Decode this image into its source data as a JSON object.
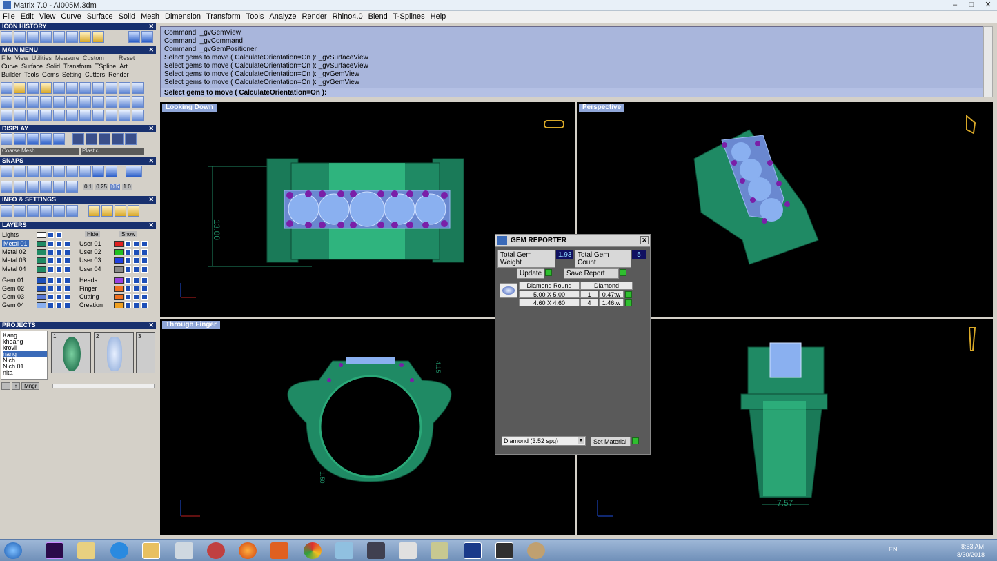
{
  "window": {
    "title": "Matrix 7.0 - AI005M.3dm",
    "controls": [
      "–",
      "□",
      "✕"
    ]
  },
  "menu": [
    "File",
    "Edit",
    "View",
    "Curve",
    "Surface",
    "Solid",
    "Mesh",
    "Dimension",
    "Transform",
    "Tools",
    "Analyze",
    "Render",
    "Rhino4.0",
    "Blend",
    "T-Splines",
    "Help"
  ],
  "left": {
    "icon_history": "ICON HISTORY",
    "main_menu": "MAIN MENU",
    "main_menu_row1": [
      "File",
      "View",
      "Utilities",
      "Measure",
      "Custom"
    ],
    "reset": "Reset",
    "main_menu_row2": [
      "Curve",
      "Surface",
      "Solid",
      "Transform",
      "TSpline",
      "Art"
    ],
    "main_menu_row3": [
      "Builder",
      "Tools",
      "Gems",
      "Setting",
      "Cutters",
      "Render"
    ],
    "display": "DISPLAY",
    "display_mesh": "Coarse Mesh",
    "display_material": "Plastic",
    "snaps": "SNAPS",
    "snap_values": [
      "0.1",
      "0.25",
      "0.5",
      "1.0"
    ],
    "info_settings": "INFO & SETTINGS",
    "layers": "LAYERS",
    "lights": "Lights",
    "hide": "Hide",
    "show": "Show",
    "layers_left": [
      "Metal 01",
      "Metal 02",
      "Metal 03",
      "Metal 04",
      "Gem 01",
      "Gem 02",
      "Gem 03",
      "Gem 04"
    ],
    "layers_right": [
      "User 01",
      "User 02",
      "User 03",
      "User 04",
      "Heads",
      "Finger",
      "Cutting",
      "Creation"
    ],
    "projects": "PROJECTS",
    "project_names": [
      "Kang",
      "kheang",
      "krovil",
      "nang",
      "Nich",
      "Nich 01",
      "nita"
    ],
    "project_thumbs": [
      "1",
      "2",
      "3"
    ],
    "mngr": "Mngr"
  },
  "command": {
    "history": [
      "Command: _gvGemView",
      "Command: _gvCommand",
      "Command: _gvGemPositioner",
      "Select gems to move ( CalculateOrientation=On ): _gvSurfaceView",
      "Select gems to move ( CalculateOrientation=On ): _gvSurfaceView",
      "Select gems to move ( CalculateOrientation=On ): _gvGemView",
      "Select gems to move ( CalculateOrientation=On ): _gvGemView"
    ],
    "prompt": "Select gems to move ( CalculateOrientation=On ):"
  },
  "viewports": {
    "top_left": "Looking Down",
    "top_right": "Perspective",
    "bottom_left": "Through Finger",
    "dim_top": "13.00",
    "dim_front_side": "4.15",
    "dim_front_bottom": "1.50",
    "dim_right": "7.57"
  },
  "gem_reporter": {
    "title": "GEM REPORTER",
    "weight_label": "Total Gem Weight",
    "weight_value": "1.93",
    "count_label": "Total Gem Count",
    "count_value": "5",
    "update": "Update",
    "save_report": "Save Report",
    "col_shape": "Diamond Round",
    "col_material": "Diamond",
    "rows": [
      {
        "size": "5.00 X 5.00",
        "count": "1",
        "carat": "0.47tw"
      },
      {
        "size": "4.60 X 4.60",
        "count": "4",
        "carat": "1.46tw"
      }
    ],
    "material_select": "Diamond     (3.52 spg)",
    "set_material": "Set Material"
  },
  "taskbar": {
    "lang": "EN",
    "time": "8:53 AM",
    "date": "8/30/2018"
  },
  "colors": {
    "metal": "#1f8a64",
    "gem": "#9ab8f0",
    "prong": "#7a1fa8",
    "viewport_bg": "#000000",
    "label_bg": "#8fa6d8"
  }
}
